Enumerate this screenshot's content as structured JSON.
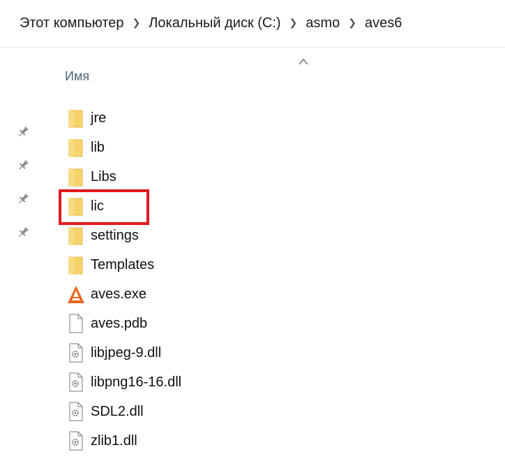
{
  "breadcrumb": {
    "items": [
      "Этот компьютер",
      "Локальный диск (C:)",
      "asmo",
      "aves6"
    ]
  },
  "column_header": "Имя",
  "files": [
    {
      "name": "jre",
      "type": "folder"
    },
    {
      "name": "lib",
      "type": "folder"
    },
    {
      "name": "Libs",
      "type": "folder"
    },
    {
      "name": "lic",
      "type": "folder",
      "highlighted": true
    },
    {
      "name": "settings",
      "type": "folder"
    },
    {
      "name": "Templates",
      "type": "folder"
    },
    {
      "name": "aves.exe",
      "type": "exe"
    },
    {
      "name": "aves.pdb",
      "type": "file"
    },
    {
      "name": "libjpeg-9.dll",
      "type": "dll"
    },
    {
      "name": "libpng16-16.dll",
      "type": "dll"
    },
    {
      "name": "SDL2.dll",
      "type": "dll"
    },
    {
      "name": "zlib1.dll",
      "type": "dll"
    }
  ],
  "colors": {
    "folder": "#f7d36b",
    "highlight": "#e0191e",
    "exe_accent": "#e8661c",
    "header_text": "#4c607a"
  },
  "icons": {
    "sort": "chevron-up-icon",
    "pin": "pin-icon",
    "folder": "folder-icon",
    "exe": "app-icon",
    "file": "file-icon",
    "dll": "dll-icon"
  }
}
